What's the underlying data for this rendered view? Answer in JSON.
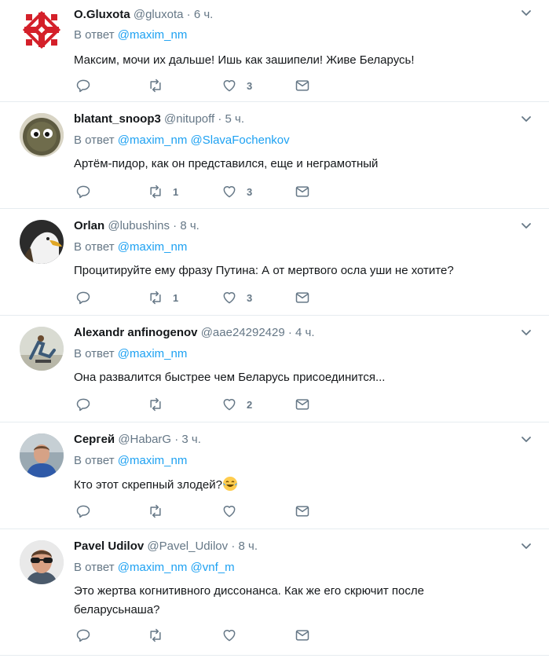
{
  "reply_prefix": "В ответ",
  "tweets": [
    {
      "name": "O.Gluxota",
      "handle": "@gluxota",
      "separator": "·",
      "time": "6 ч.",
      "mentions": [
        "@maxim_nm"
      ],
      "text": "Максим, мочи их дальше! Ишь как зашипели! Живе Беларусь!",
      "retweets": "",
      "likes": "3",
      "avatar": "ornament"
    },
    {
      "name": "blatant_snoop3",
      "handle": "@nitupoff",
      "separator": "·",
      "time": "5 ч.",
      "mentions": [
        "@maxim_nm",
        "@SlavaFochenkov"
      ],
      "text": "Артём-пидор, как он представился, еще и неграмотный",
      "retweets": "1",
      "likes": "3",
      "avatar": "fuzzball"
    },
    {
      "name": "Orlan",
      "handle": "@lubushins",
      "separator": "·",
      "time": "8 ч.",
      "mentions": [
        "@maxim_nm"
      ],
      "text": "Процитируйте ему фразу Путина: А от мертвого осла уши не хотите?",
      "retweets": "1",
      "likes": "3",
      "avatar": "eagle"
    },
    {
      "name": "Alexandr anfinogenov",
      "handle": "@aae24292429",
      "separator": "·",
      "time": "4 ч.",
      "mentions": [
        "@maxim_nm"
      ],
      "text": "Она развалится быстрее чем Беларусь присоединится...",
      "retweets": "",
      "likes": "2",
      "avatar": "figure"
    },
    {
      "name": "Сергей",
      "handle": "@HabarG",
      "separator": "·",
      "time": "3 ч.",
      "mentions": [
        "@maxim_nm"
      ],
      "text": "Кто этот скрепный злодей?",
      "emoji": "face-with-tears-of-joy",
      "retweets": "",
      "likes": "",
      "avatar": "man-blue"
    },
    {
      "name": "Pavel Udilov",
      "handle": "@Pavel_Udilov",
      "separator": "·",
      "time": "8 ч.",
      "mentions": [
        "@maxim_nm",
        "@vnf_m"
      ],
      "text": "Это жертва когнитивного диссонанса. Как же его скрючит после беларусьнаша?",
      "retweets": "",
      "likes": "",
      "avatar": "man-glasses"
    }
  ],
  "colors": {
    "accent": "#1da1f2",
    "muted": "#657786",
    "divider": "#e6ecf0",
    "text": "#14171a"
  }
}
